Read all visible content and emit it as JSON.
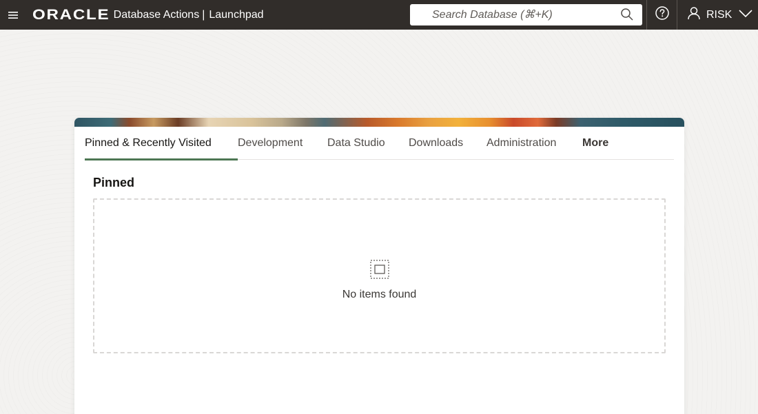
{
  "header": {
    "menu_icon": "hamburger-icon",
    "brand": "ORACLE",
    "app_name": "Database Actions",
    "separator": "|",
    "page_name": "Launchpad",
    "search": {
      "placeholder": "Search Database (⌘+K)",
      "value": ""
    },
    "help_icon": "help-icon",
    "user": {
      "name": "RISK",
      "icon": "user-icon"
    }
  },
  "tabs": [
    {
      "label": "Pinned & Recently Visited",
      "active": true
    },
    {
      "label": "Development",
      "active": false
    },
    {
      "label": "Data Studio",
      "active": false
    },
    {
      "label": "Downloads",
      "active": false
    },
    {
      "label": "Administration",
      "active": false
    },
    {
      "label": "More",
      "active": false
    }
  ],
  "pinned": {
    "title": "Pinned",
    "empty_icon": "empty-box-icon",
    "empty_text": "No items found"
  },
  "colors": {
    "header_bg": "#312d2a",
    "active_tab_underline": "#4d7753",
    "page_bg": "#f2f1ef"
  }
}
